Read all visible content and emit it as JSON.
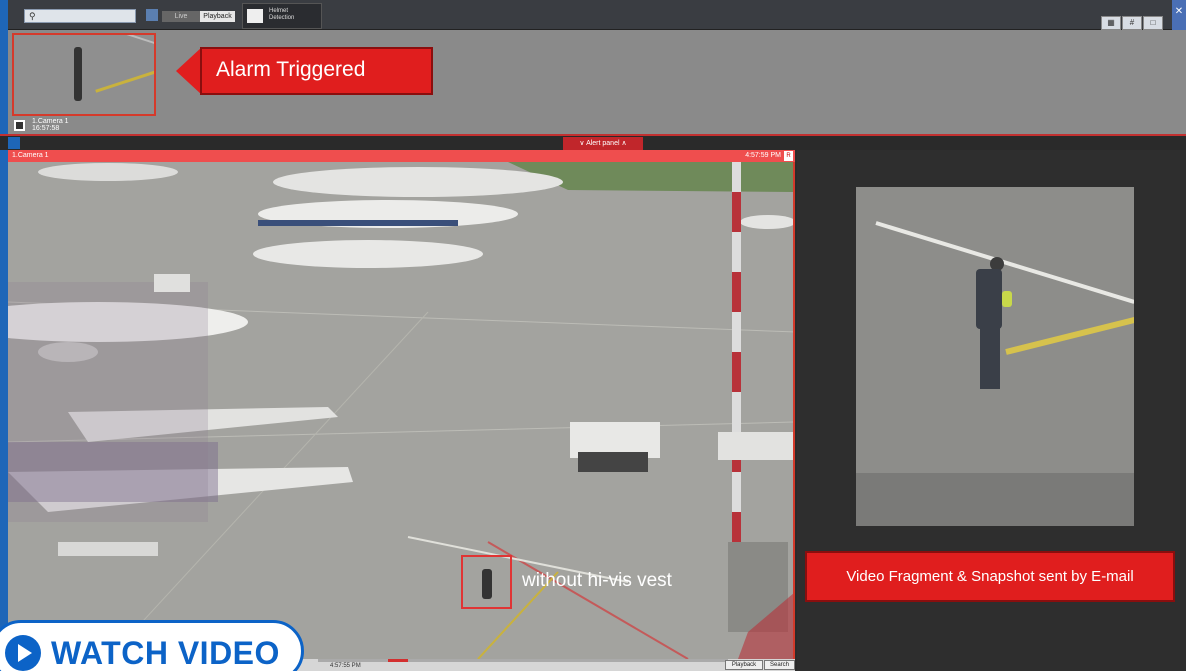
{
  "toolbar": {
    "search_placeholder": "",
    "live_tab": "Live",
    "playback_tab": "Playback",
    "camera_tab_title": "Helmet\nDetection"
  },
  "alarm": {
    "banner_text": "Alarm Triggered",
    "thumb_camera": "1.Camera 1",
    "thumb_time": "16:57:58"
  },
  "alert_panel": {
    "label": "Alert panel"
  },
  "camera": {
    "name": "1.Camera 1",
    "time": "4:57:59 PM",
    "rec_badge": "R",
    "annotation": "without hi-vis vest"
  },
  "timeline": {
    "time": "4:57:55 PM",
    "playback_btn": "Playback",
    "search_btn": "Search"
  },
  "side_panel": {
    "email_text": "Video Fragment & Snapshot sent by E-mail"
  },
  "overlay": {
    "watch_label": "WATCH VIDEO"
  },
  "colors": {
    "alarm_red": "#e01e1e",
    "accent_blue": "#1e66b8",
    "watch_blue": "#0c63c7"
  }
}
